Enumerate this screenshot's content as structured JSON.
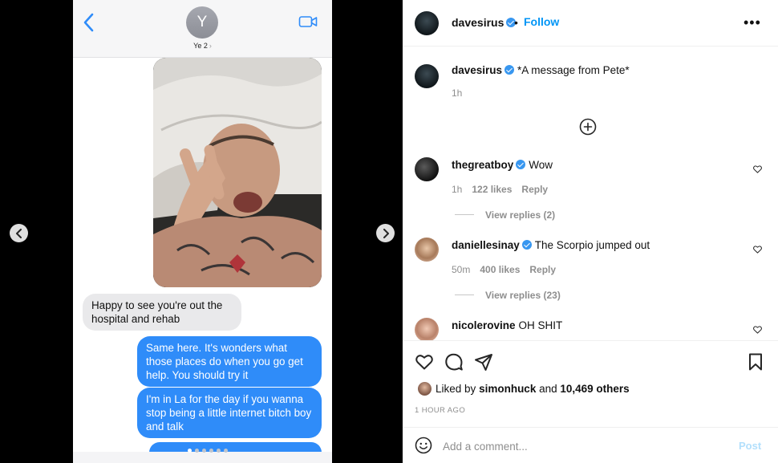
{
  "media": {
    "contact_initial": "Y",
    "contact_name": "Ye 2",
    "messages": [
      {
        "dir": "in",
        "text": "Happy to see you're out the hospital and rehab"
      },
      {
        "dir": "out",
        "text": "Same here. It's wonders what those places do when you go get help. You should try it"
      },
      {
        "dir": "out",
        "text": "I'm in La for the day if you wanna stop being a little internet bitch boy and talk"
      }
    ],
    "carousel_dots": 6,
    "carousel_active": 1
  },
  "post": {
    "author": "davesirus",
    "separator": "•",
    "follow_label": "Follow",
    "more_label": "•••",
    "caption": "*A message from Pete*",
    "caption_time": "1h"
  },
  "comments": [
    {
      "user": "thegreatboy",
      "verified": true,
      "text": "Wow",
      "time": "1h",
      "likes": "122 likes",
      "reply_label": "Reply",
      "view_replies": "View replies (2)"
    },
    {
      "user": "daniellesinay",
      "verified": true,
      "text": "The Scorpio jumped out",
      "time": "50m",
      "likes": "400 likes",
      "reply_label": "Reply",
      "view_replies": "View replies (23)"
    },
    {
      "user": "nicolerovine",
      "verified": false,
      "text": "OH SHIT"
    }
  ],
  "likes": {
    "prefix": "Liked by",
    "user": "simonhuck",
    "middle": "and",
    "others": "10,469 others"
  },
  "timestamp": "1 HOUR AGO",
  "add_comment": {
    "placeholder": "Add a comment...",
    "post_label": "Post"
  },
  "colors": {
    "accent": "#0095f6",
    "imessage_blue": "#2f8cf9",
    "imessage_gray": "#e9e9eb",
    "verified": "#3897f0"
  }
}
